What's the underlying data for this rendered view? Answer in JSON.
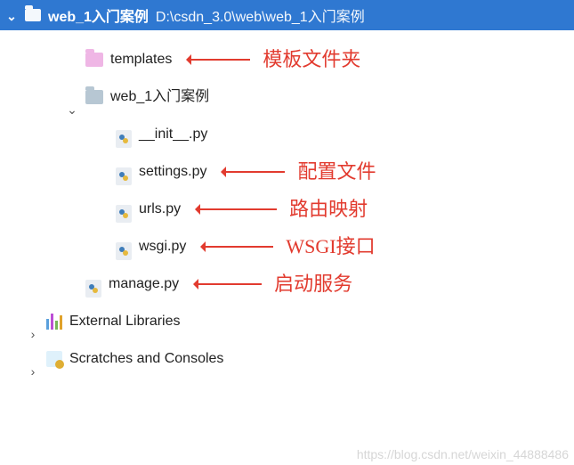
{
  "root": {
    "name": "web_1入门案例",
    "path": "D:\\csdn_3.0\\web\\web_1入门案例"
  },
  "tree": {
    "templates_label": "templates",
    "project_label": "web_1入门案例",
    "files": {
      "init": "__init__.py",
      "settings": "settings.py",
      "urls": "urls.py",
      "wsgi": "wsgi.py",
      "manage": "manage.py"
    },
    "external_libraries_label": "External Libraries",
    "scratches_label": "Scratches and Consoles"
  },
  "annotations": {
    "templates": "模板文件夹",
    "settings": "配置文件",
    "urls": "路由映射",
    "wsgi": "WSGI接口",
    "manage": "启动服务"
  },
  "watermark": "https://blog.csdn.net/weixin_44888486"
}
